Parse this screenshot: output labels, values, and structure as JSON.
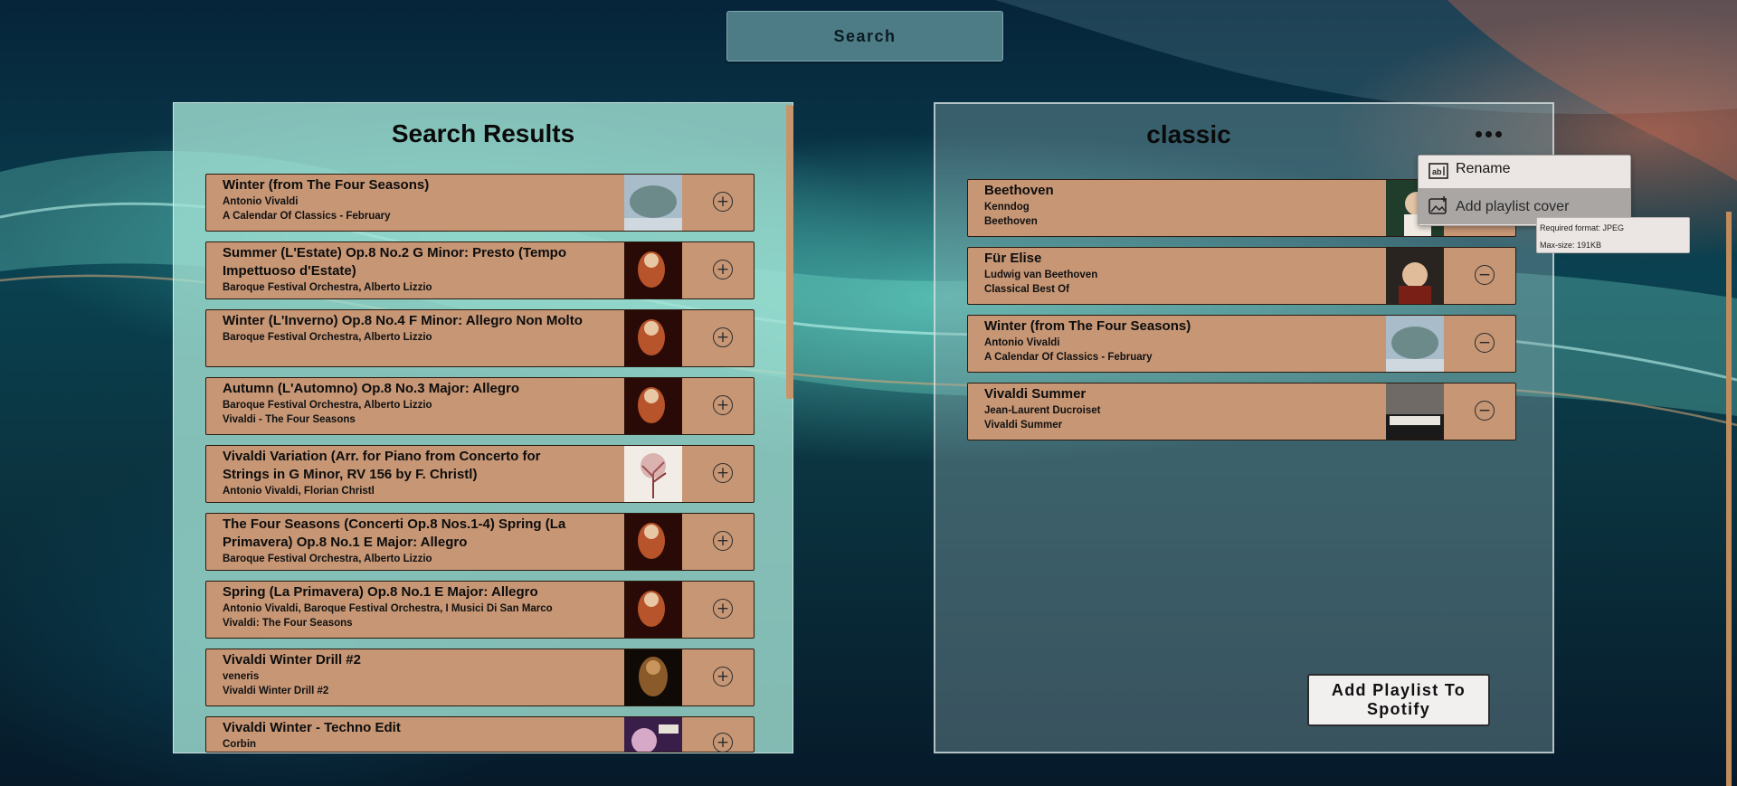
{
  "search": {
    "label": "Search"
  },
  "results": {
    "title": "Search Results",
    "items": [
      {
        "title": "Winter (from The Four Seasons)",
        "artist": "Antonio Vivaldi",
        "album": "A Calendar Of Classics - February",
        "cover": "tree-cover",
        "action": "add-icon"
      },
      {
        "title": "Summer (L'Estate) Op.8 No.2 G Minor: Presto (Tempo Impettuoso d'Estate)",
        "artist": "Baroque Festival Orchestra, Alberto Lizzio",
        "album": "",
        "cover": "vivaldi-cover",
        "action": "add-icon"
      },
      {
        "title": "Winter (L'Inverno) Op.8 No.4 F Minor: Allegro Non Molto",
        "artist": "Baroque Festival Orchestra, Alberto Lizzio",
        "album": "",
        "cover": "vivaldi-cover",
        "action": "add-icon"
      },
      {
        "title": "Autumn (L'Automno) Op.8 No.3 Major: Allegro",
        "artist": "Baroque Festival Orchestra, Alberto Lizzio",
        "album": "Vivaldi - The Four Seasons",
        "cover": "vivaldi-cover",
        "action": "add-icon"
      },
      {
        "title": "Vivaldi Variation (Arr. for Piano from Concerto for Strings in G Minor, RV 156 by F. Christl)",
        "artist": "Antonio Vivaldi, Florian Christl",
        "album": "",
        "cover": "florian-cover",
        "action": "add-icon"
      },
      {
        "title": "The Four Seasons (Concerti Op.8 Nos.1-4) Spring (La Primavera) Op.8 No.1 E Major: Allegro",
        "artist": "Baroque Festival Orchestra, Alberto Lizzio",
        "album": "",
        "cover": "vivaldi-cover",
        "action": "add-icon"
      },
      {
        "title": "Spring (La Primavera) Op.8 No.1 E Major: Allegro",
        "artist": "Antonio Vivaldi, Baroque Festival Orchestra, I Musici Di San Marco",
        "album": "Vivaldi: The Four Seasons",
        "cover": "vivaldi-cover",
        "action": "add-icon"
      },
      {
        "title": "Vivaldi Winter Drill #2",
        "artist": "veneris",
        "album": "Vivaldi Winter Drill #2",
        "cover": "drill-cover",
        "action": "add-icon"
      },
      {
        "title": "Vivaldi Winter - Techno Edit",
        "artist": "Corbin",
        "album": "",
        "cover": "techno-cover",
        "action": "add-icon"
      }
    ]
  },
  "playlist": {
    "title": "classic",
    "items": [
      {
        "title": "Beethoven",
        "artist": "Kenndog",
        "album": "Beethoven",
        "cover": "beethoven-portrait-cover",
        "action": "remove-icon"
      },
      {
        "title": "Für Elise",
        "artist": "Ludwig van Beethoven",
        "album": "Classical Best Of",
        "cover": "beethoven-cover",
        "action": "remove-icon"
      },
      {
        "title": "Winter (from The Four Seasons)",
        "artist": "Antonio Vivaldi",
        "album": "A Calendar Of Classics - February",
        "cover": "tree-cover",
        "action": "remove-icon"
      },
      {
        "title": "Vivaldi Summer",
        "artist": "Jean-Laurent Ducroiset",
        "album": "Vivaldi Summer",
        "cover": "piano-cover",
        "action": "remove-icon"
      }
    ],
    "add_to_spotify": "Add Playlist To Spotify"
  },
  "menu": {
    "rename": "Rename",
    "add_cover": "Add playlist cover"
  },
  "tooltip": {
    "format": "Required format: JPEG",
    "size": "Max-size: 191KB"
  },
  "colors": {
    "track_bg": "#c69675",
    "accent": "#c18c5c"
  }
}
